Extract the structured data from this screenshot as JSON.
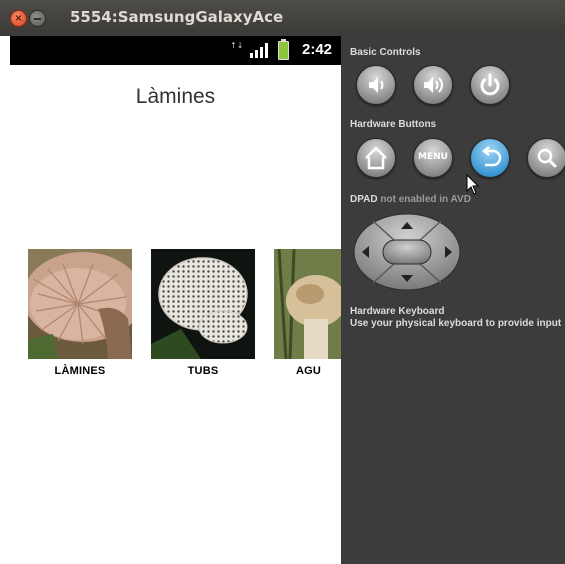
{
  "window": {
    "title": "5554:SamsungGalaxyAce"
  },
  "status_bar": {
    "time": "2:42",
    "data_glyph": "↑↓"
  },
  "app": {
    "title": "Làmines",
    "gallery": [
      {
        "label": "LÀMINES"
      },
      {
        "label": "TUBS"
      },
      {
        "label": "AGU"
      }
    ]
  },
  "panel": {
    "basic_controls": "Basic Controls",
    "hardware_buttons": "Hardware Buttons",
    "menu_label": "MENU",
    "dpad_prefix": "DPAD",
    "dpad_note": "not enabled in AVD",
    "keyboard_title": "Hardware Keyboard",
    "keyboard_note": "Use your physical keyboard to provide input"
  },
  "colors": {
    "accent_active": "#3f9ad6",
    "panel_bg": "#3c3c3c",
    "titlebar_bg": "#3f3e3b"
  }
}
